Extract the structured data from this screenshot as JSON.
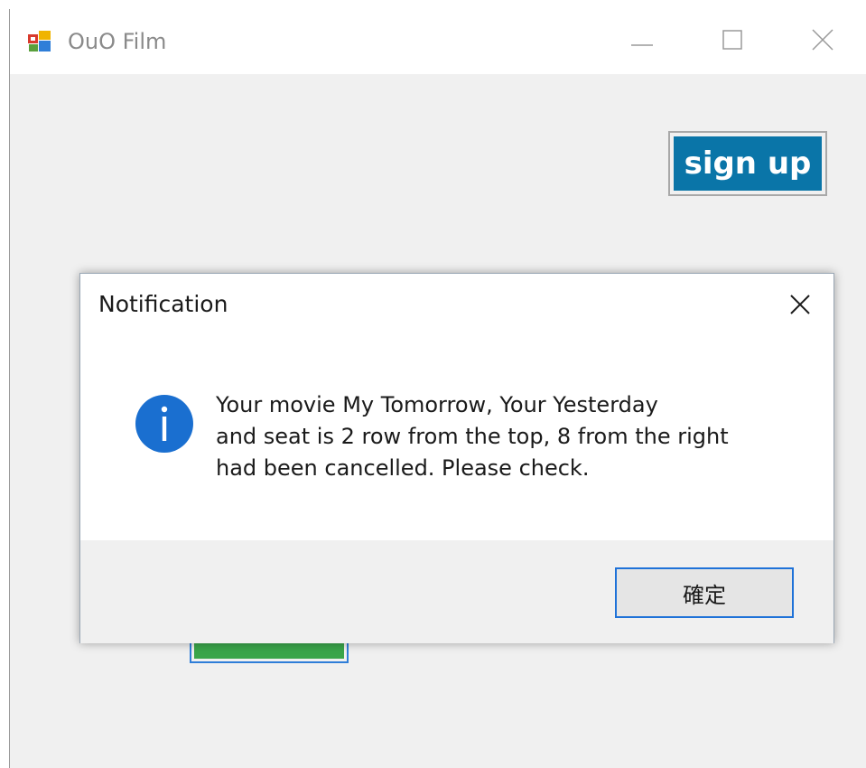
{
  "window": {
    "title": "OuO Film",
    "app_icon": "app-window-icon",
    "controls": {
      "minimize_icon": "minimize-icon",
      "maximize_icon": "maximize-icon",
      "close_icon": "close-icon"
    }
  },
  "main": {
    "signup_label": "sign up",
    "signup_color": "#0a75a8",
    "hidden_button_color": "#3aa54a"
  },
  "dialog": {
    "title": "Notification",
    "icon": "info-icon",
    "close_icon": "close-icon",
    "message_lines": [
      "Your movie My Tomorrow, Your Yesterday",
      "and seat is 2 row from the top, 8 from the right",
      "had been cancelled. Please check."
    ],
    "ok_label": "確定",
    "accent_color": "#1f72d8"
  }
}
